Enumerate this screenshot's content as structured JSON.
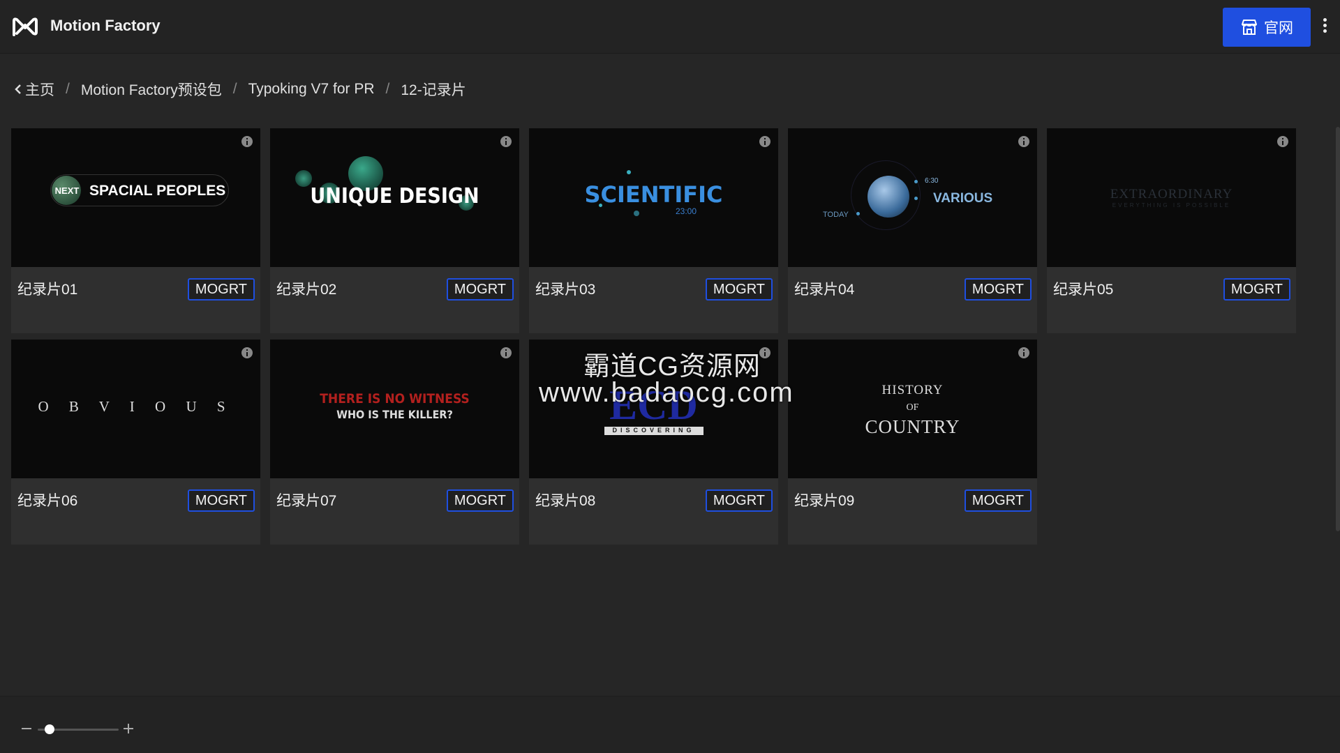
{
  "app": {
    "title": "Motion Factory",
    "logo_icon": "motion-factory-logo-icon"
  },
  "header": {
    "site_button_label": "官网",
    "site_button_icon": "store-icon",
    "more_icon": "more-vertical-icon",
    "accent": "#1f4fe0"
  },
  "breadcrumb": {
    "items": [
      "主页",
      "Motion Factory预设包",
      "Typoking V7 for PR",
      "12-记录片"
    ],
    "separator": "/"
  },
  "cards": [
    {
      "title": "纪录片01",
      "badge": "MOGRT",
      "thumb_text": "SPACIAL PEOPLES",
      "thumb_sub": "NEXT"
    },
    {
      "title": "纪录片02",
      "badge": "MOGRT",
      "thumb_text": "UNIQUE DESIGN"
    },
    {
      "title": "纪录片03",
      "badge": "MOGRT",
      "thumb_text": "SCIENTIFIC",
      "thumb_sub": "23:00"
    },
    {
      "title": "纪录片04",
      "badge": "MOGRT",
      "thumb_text": "VARIOUS",
      "thumb_sub": "TODAY",
      "thumb_time": "6:30"
    },
    {
      "title": "纪录片05",
      "badge": "MOGRT",
      "thumb_text": "EXTRAORDINARY",
      "thumb_sub": "EVERYTHING IS POSSIBLE"
    },
    {
      "title": "纪录片06",
      "badge": "MOGRT",
      "thumb_text": "O B V I O U S"
    },
    {
      "title": "纪录片07",
      "badge": "MOGRT",
      "thumb_text": "THERE IS NO WITNESS",
      "thumb_sub": "WHO IS THE KILLER?"
    },
    {
      "title": "纪录片08",
      "badge": "MOGRT",
      "thumb_text": "ECD",
      "thumb_sub": "DISCOVERING"
    },
    {
      "title": "纪录片09",
      "badge": "MOGRT",
      "thumb_text": "HISTORY",
      "thumb_mid": "OF",
      "thumb_sub": "COUNTRY"
    }
  ],
  "watermark": {
    "line1": "霸道CG资源网",
    "line2": "www.badaocg.com"
  },
  "zoom": {
    "level": 0.15
  }
}
